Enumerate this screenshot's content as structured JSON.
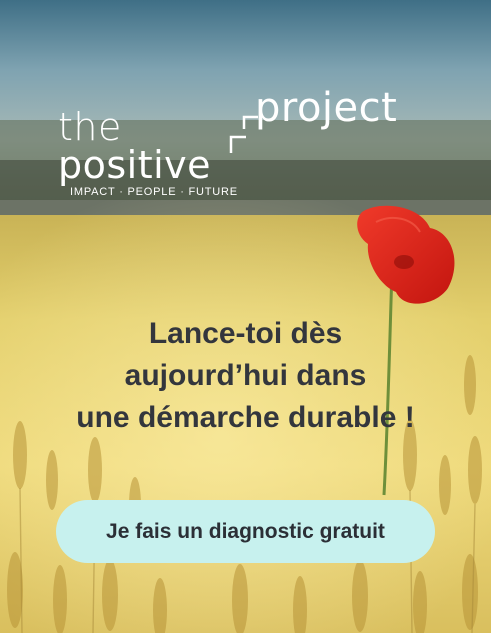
{
  "logo": {
    "word_the": "the",
    "word_positive": "positive",
    "word_project": "project",
    "tagline": "IMPACT · PEOPLE · FUTURE"
  },
  "headline": {
    "line1": "Lance-toi dès",
    "line2": "aujourd’hui dans",
    "line3": "une démarche durable !"
  },
  "cta": {
    "label": "Je fais un diagnostic gratuit"
  },
  "colors": {
    "headline_text": "#33363d",
    "cta_background": "#c7f1ee",
    "cta_text": "#2b2f36",
    "logo": "#ffffff",
    "poppy": "#e2231a"
  },
  "image": {
    "subject": "wheat field with a red poppy"
  }
}
